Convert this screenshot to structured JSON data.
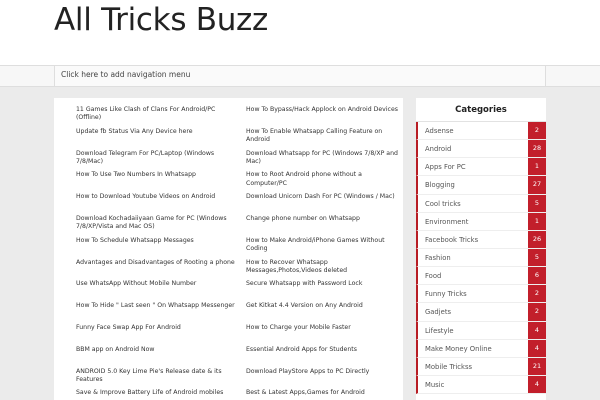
{
  "site": {
    "title": "All Tricks Buzz"
  },
  "nav": {
    "placeholder_link": "Click here to add navigation menu"
  },
  "posts": {
    "left": [
      "11 Games Like Clash of Clans For Android/PC (Offline)",
      "Update fb Status Via Any Device here",
      "Download Telegram For PC/Laptop (Windows 7/8/Mac)",
      "How To Use Two Numbers In Whatsapp",
      "How to Download Youtube Videos on Android",
      "Download Kochadaiiyaan Game for PC (Windows 7/8/XP/Vista and Mac OS)",
      "How To Schedule Whatsapp Messages",
      "Advantages and Disadvantages of Rooting a phone",
      "Use WhatsApp Without    Mobile Number",
      "How To Hide \" Last seen \" On Whatsapp Messenger",
      "Funny Face Swap App For Android",
      "BBM app on Android Now",
      "ANDROID 5.0 Key Lime Pie's   Release date & its Features",
      "Save & Improve Battery Life of Android mobiles"
    ],
    "right": [
      "How To Bypass/Hack Applock on Android Devices",
      "How To Enable Whatsapp Calling Feature on Android",
      "Download Whatsapp for PC (Windows 7/8/XP and Mac)",
      "How to Root Android phone without a Computer/PC",
      "Download Unicorn Dash For PC    (Windows / Mac)",
      "Change phone number on Whatsapp",
      "How to Make Android/iPhone Games Without Coding",
      "How to Recover Whatsapp Messages,Photos,Videos deleted",
      "Secure Whatsapp with Password Lock",
      "Get Kitkat 4.4 Version on Any Android",
      "How to Charge your Mobile Faster",
      "Essential Android Apps for Students",
      "Download PlayStore Apps to PC Directly",
      "Best & Latest Apps,Games for Android"
    ]
  },
  "sidebar": {
    "title": "Categories",
    "categories": [
      {
        "label": "Adsense",
        "count": "2"
      },
      {
        "label": "Android",
        "count": "28"
      },
      {
        "label": "Apps For PC",
        "count": "1"
      },
      {
        "label": "Blogging",
        "count": "27"
      },
      {
        "label": "Cool tricks",
        "count": "5"
      },
      {
        "label": "Environment",
        "count": "1"
      },
      {
        "label": "Facebook Tricks",
        "count": "26"
      },
      {
        "label": "Fashion",
        "count": "5"
      },
      {
        "label": "Food",
        "count": "6"
      },
      {
        "label": "Funny Tricks",
        "count": "2"
      },
      {
        "label": "Gadjets",
        "count": "2"
      },
      {
        "label": "Lifestyle",
        "count": "4"
      },
      {
        "label": "Make Money Online",
        "count": "4"
      },
      {
        "label": "Mobile Trickss",
        "count": "21"
      },
      {
        "label": "Music",
        "count": "4"
      }
    ]
  },
  "colors": {
    "accent": "#c21f2b",
    "bullet": "#c9302c"
  }
}
